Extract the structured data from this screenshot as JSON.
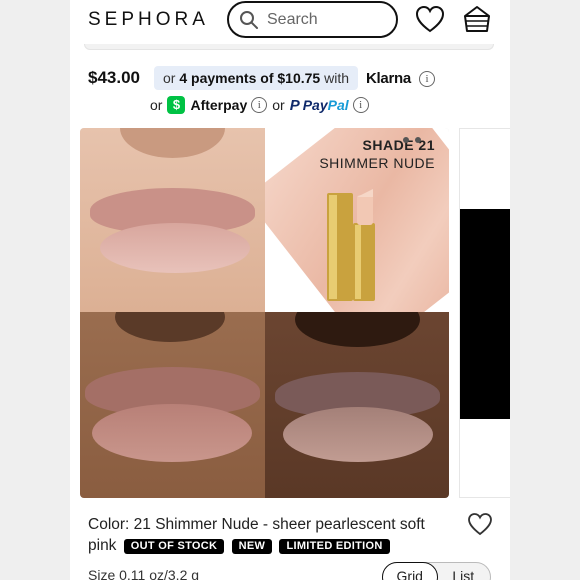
{
  "header": {
    "logo": "SEPHORA",
    "search_placeholder": "Search",
    "icons": [
      "search-icon",
      "heart-icon",
      "basket-icon"
    ]
  },
  "pricing": {
    "price": "$43.00",
    "installments_prefix": "or",
    "installments_bold": "4 payments of $10.75",
    "installments_suffix": "with",
    "klarna": "Klarna",
    "or1": "or",
    "afterpay": "Afterpay",
    "or2": "or",
    "paypal_pay": "Pay",
    "paypal_pal": "Pal",
    "info_glyph": "i"
  },
  "product_image": {
    "shade_line1": "SHADE 21",
    "shade_line2": "SHIMMER NUDE"
  },
  "details": {
    "color_text": "Color: 21 Shimmer Nude - sheer pearlescent soft pink",
    "badges": [
      "OUT OF STOCK",
      "NEW",
      "LIMITED EDITION"
    ],
    "size_text": "Size 0.11 oz/3.2 g",
    "view_toggle": [
      "Grid",
      "List"
    ],
    "selected_view": "Grid"
  },
  "colors": {
    "installments_bg": "#e6edf8",
    "cashapp_green": "#00c244",
    "paypal_dark": "#0f2a6b",
    "paypal_light": "#179bd7"
  }
}
